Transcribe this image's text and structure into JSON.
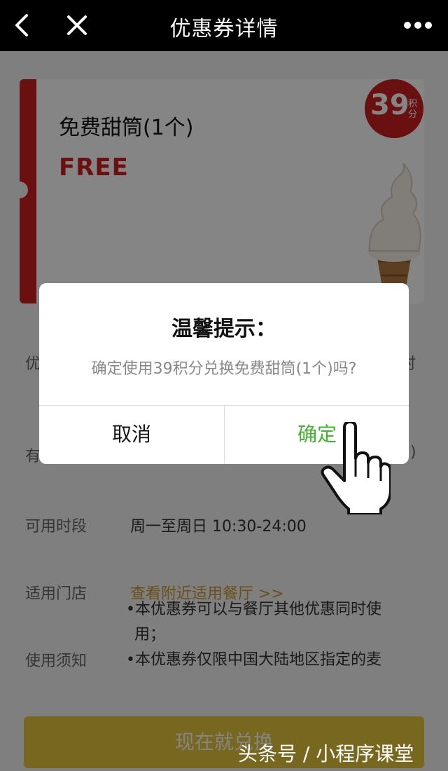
{
  "nav": {
    "title": "优惠券详情",
    "back_icon": "chevron-left-icon",
    "close_icon": "close-icon",
    "more_icon": "more-dots-icon"
  },
  "coupon": {
    "name": "免费甜筒(1个)",
    "price": "FREE",
    "points_value": "39",
    "points_unit": "积分",
    "accent_color": "#cc1f22"
  },
  "rows": [
    {
      "label": "可用时段",
      "value": "周一至周日 10:30-24:00"
    },
    {
      "label": "适用门店",
      "value": "查看附近适用餐厅 >>"
    },
    {
      "label": "使用须知",
      "value": ""
    }
  ],
  "partial_labels": {
    "row1": "优",
    "row2": "有",
    "row1_right": "时",
    "row2_right": ")"
  },
  "notes": [
    "•本优惠券可以与餐厅其他优惠同时使",
    "用；",
    "•本优惠券仅限中国大陆地区指定的麦"
  ],
  "bottom_button": "现在就兑换",
  "watermark": "头条号 / 小程序课堂",
  "dialog": {
    "title": "温馨提示：",
    "message": "确定使用39积分兑换免费甜筒(1个)吗?",
    "cancel": "取消",
    "confirm": "确定",
    "confirm_color": "#43b52d"
  }
}
